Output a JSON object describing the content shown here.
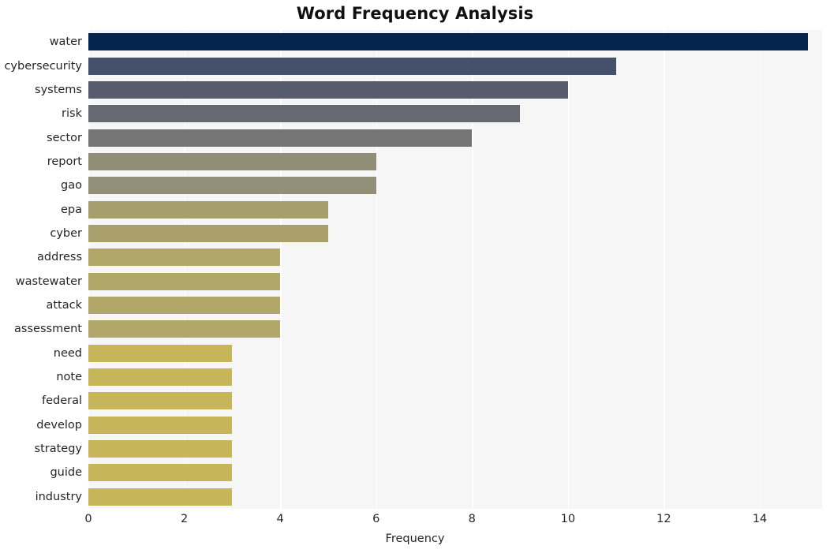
{
  "chart_data": {
    "type": "bar",
    "orientation": "horizontal",
    "title": "Word Frequency Analysis",
    "xlabel": "Frequency",
    "ylabel": "",
    "xlim": [
      0,
      15.3
    ],
    "ylim": [
      0,
      20
    ],
    "grid": true,
    "grid_color": "#ffffff",
    "plot_background": "#f6f6f6",
    "legend": false,
    "xticks": [
      0,
      2,
      4,
      6,
      8,
      10,
      12,
      14
    ],
    "xtick_labels": [
      "0",
      "2",
      "4",
      "6",
      "8",
      "10",
      "12",
      "14"
    ],
    "categories": [
      "water",
      "cybersecurity",
      "systems",
      "risk",
      "sector",
      "report",
      "gao",
      "epa",
      "cyber",
      "address",
      "wastewater",
      "attack",
      "assessment",
      "need",
      "note",
      "federal",
      "develop",
      "strategy",
      "guide",
      "industry"
    ],
    "values": [
      15,
      11,
      10,
      9,
      8,
      6,
      6,
      5,
      5,
      4,
      4,
      4,
      4,
      3,
      3,
      3,
      3,
      3,
      3,
      3
    ],
    "bar_colors": [
      "#04254e",
      "#45506b",
      "#565b6e",
      "#666970",
      "#757575",
      "#918e78",
      "#928f78",
      "#a79e6d",
      "#a89f6c",
      "#b0a768",
      "#b0a768",
      "#b0a768",
      "#b0a768",
      "#c6b659",
      "#c6b659",
      "#c6b659",
      "#c6b659",
      "#c6b659",
      "#c6b659",
      "#c6b659"
    ]
  }
}
